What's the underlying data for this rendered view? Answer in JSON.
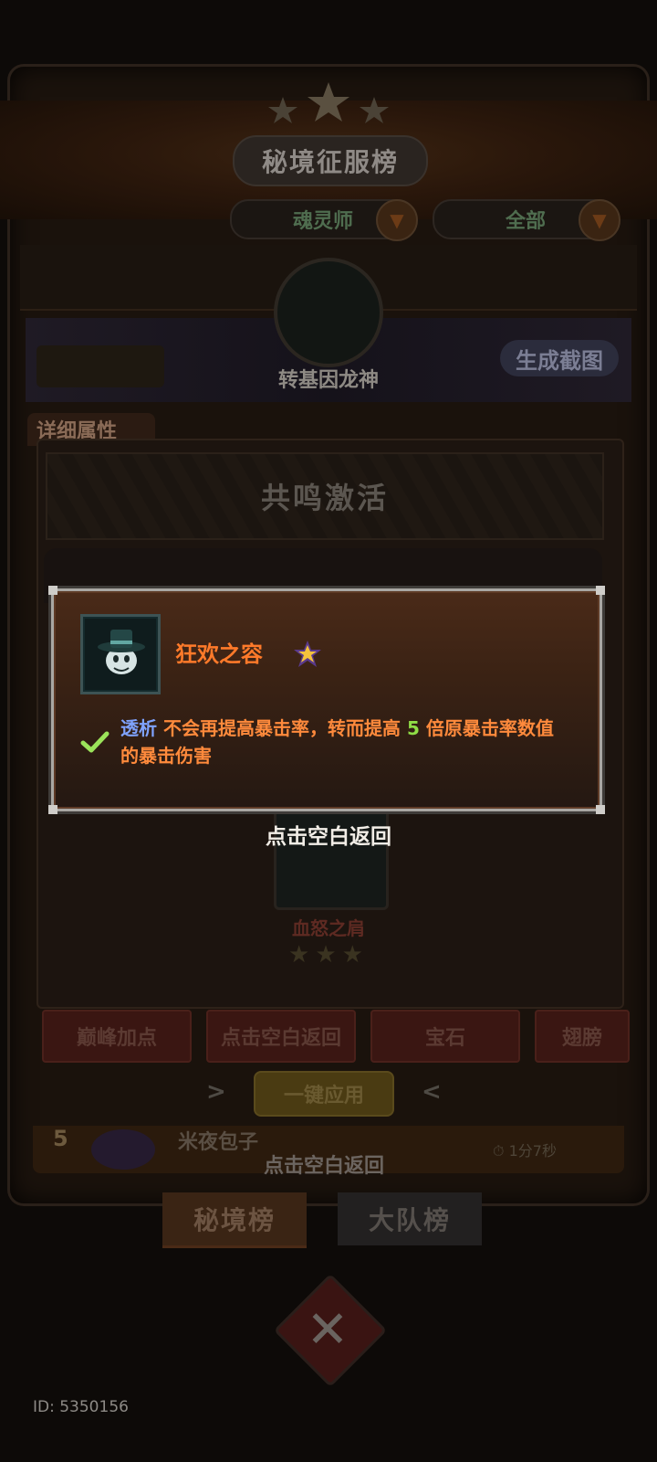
{
  "header": {
    "title": "秘境征服榜",
    "filter_class": "魂灵师",
    "filter_scope": "全部"
  },
  "player": {
    "name": "转基因龙神",
    "screenshot_button": "生成截图"
  },
  "detail": {
    "tab_label": "详细属性",
    "resonance_label": "共鸣激活",
    "equipment": {
      "name": "血怒之肩",
      "stars": "★★★"
    },
    "tabs": [
      "巅峰加点",
      "点击空白返回",
      "宝石",
      "翅膀"
    ],
    "apply_button": "一键应用"
  },
  "ranking_row": {
    "rank": "5",
    "name": "米夜包子",
    "time": "1分7秒",
    "hint": "点击空白返回"
  },
  "bottom_tabs": [
    "秘境榜",
    "大队榜"
  ],
  "footer": {
    "id_text": "ID: 5350156"
  },
  "popup": {
    "item_name": "狂欢之容",
    "keyword": "透析",
    "desc_part1": " 不会再提高暴击率，转而提高 ",
    "multiplier": "5",
    "desc_part2": " 倍原暴击率数值的暴击伤害",
    "dismiss_hint": "点击空白返回",
    "icons": {
      "item": "top-hat-mask-icon",
      "rarity": "purple-star-icon",
      "status": "check-icon"
    },
    "colors": {
      "item_name": "#ff7a2a",
      "keyword": "#7fa3ff",
      "multiplier": "#8fdd46",
      "description": "#ff8a3c"
    }
  }
}
